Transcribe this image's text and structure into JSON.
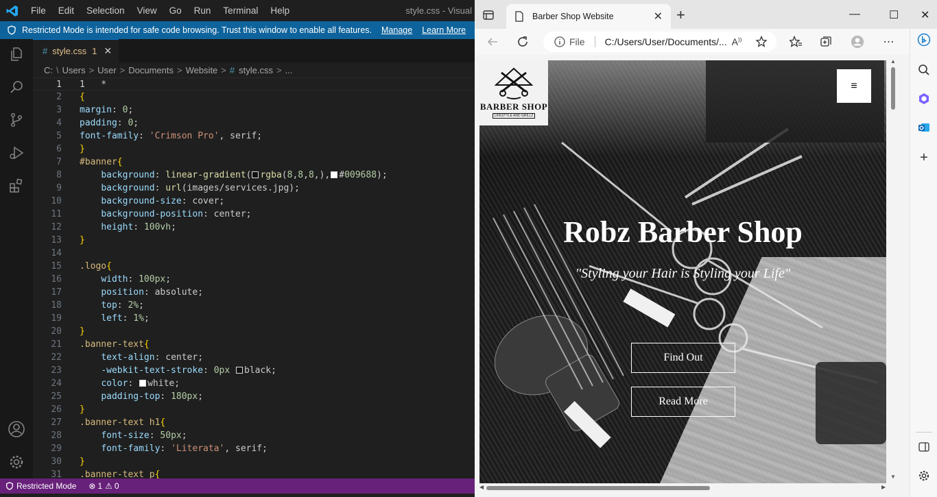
{
  "vscode": {
    "menu": [
      "File",
      "Edit",
      "Selection",
      "View",
      "Go",
      "Run",
      "Terminal",
      "Help"
    ],
    "window_title": "style.css - Visual",
    "banner": {
      "text": "Restricted Mode is intended for safe code browsing. Trust this window to enable all features.",
      "manage": "Manage",
      "learn_more": "Learn More"
    },
    "tab": {
      "name": "style.css",
      "badge": "1",
      "close": "✕"
    },
    "breadcrumb": [
      "C:",
      "Users",
      "User",
      "Documents",
      "Website",
      "style.css",
      "..."
    ],
    "code_lines": [
      {
        "n": "1",
        "text": "1   *"
      },
      {
        "n": "2",
        "text": "{"
      },
      {
        "n": "3",
        "text": "margin: 0;"
      },
      {
        "n": "4",
        "text": "padding: 0;"
      },
      {
        "n": "5",
        "text": "font-family: 'Crimson Pro', serif;"
      },
      {
        "n": "6",
        "text": "}"
      },
      {
        "n": "7",
        "text": "#banner{"
      },
      {
        "n": "8",
        "text": "    background: linear-gradient(□rgba(8,8,8,),■#009688);"
      },
      {
        "n": "9",
        "text": "    background: url(images/services.jpg);"
      },
      {
        "n": "10",
        "text": "    background-size: cover;"
      },
      {
        "n": "11",
        "text": "    background-position: center;"
      },
      {
        "n": "12",
        "text": "    height: 100vh;"
      },
      {
        "n": "13",
        "text": "}"
      },
      {
        "n": "14",
        "text": ""
      },
      {
        "n": "15",
        "text": ".logo{"
      },
      {
        "n": "16",
        "text": "    width: 100px;"
      },
      {
        "n": "17",
        "text": "    position: absolute;"
      },
      {
        "n": "18",
        "text": "    top: 2%;"
      },
      {
        "n": "19",
        "text": "    left: 1%;"
      },
      {
        "n": "20",
        "text": "}"
      },
      {
        "n": "21",
        "text": ".banner-text{"
      },
      {
        "n": "22",
        "text": "    text-align: center;"
      },
      {
        "n": "23",
        "text": "    -webkit-text-stroke: 0px □black;"
      },
      {
        "n": "24",
        "text": "    color: ■white;"
      },
      {
        "n": "25",
        "text": "    padding-top: 180px;"
      },
      {
        "n": "26",
        "text": "}"
      },
      {
        "n": "27",
        "text": ".banner-text h1{"
      },
      {
        "n": "28",
        "text": "    font-size: 50px;"
      },
      {
        "n": "29",
        "text": "    font-family: 'Literata', serif;"
      },
      {
        "n": "30",
        "text": "}"
      },
      {
        "n": "31",
        "text": ".banner-text p{"
      }
    ],
    "status": {
      "restricted": "Restricted Mode",
      "errors": "1",
      "warnings": "0"
    },
    "colors": {
      "banner": "#0e639c",
      "status": "#68217a",
      "accent": "#0078d4"
    }
  },
  "edge": {
    "tab_title": "Barber Shop Website",
    "address": {
      "scheme": "File",
      "url": "C:/Users/User/Documents/..."
    },
    "site": {
      "logo_title": "BARBER SHOP",
      "logo_sub": "LIFESTYLE AND GRILLZ",
      "menu_icon": "≡",
      "heading": "Robz Barber Shop",
      "tagline": "\"Styling your Hair is Styling your Life\"",
      "btn_find": "Find Out",
      "btn_read": "Read More"
    }
  }
}
